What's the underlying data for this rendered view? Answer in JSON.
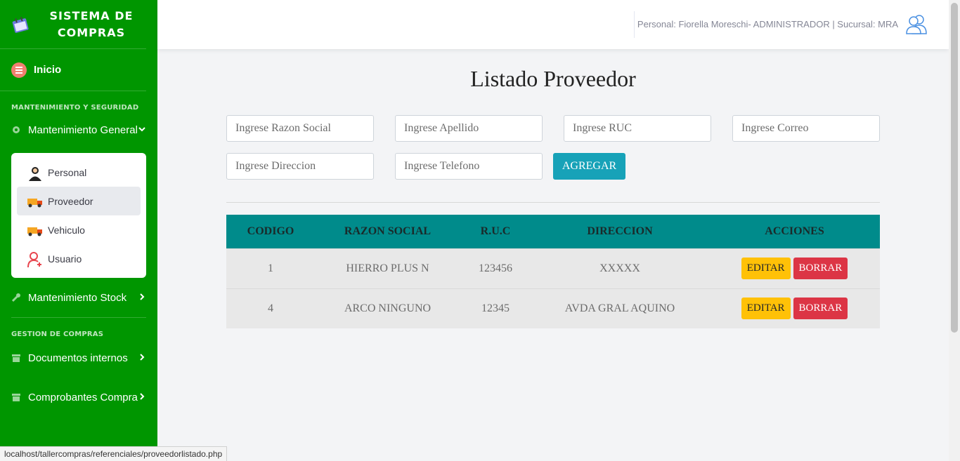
{
  "brand": {
    "line1": "SISTEMA DE",
    "line2": "COMPRAS"
  },
  "sidebar": {
    "home": "Inicio",
    "heading1": "MANTENIMIENTO Y SEGURIDAD",
    "mant_general": "Mantenimiento General",
    "submenu": [
      "Personal",
      "Proveedor",
      "Vehiculo",
      "Usuario"
    ],
    "active_submenu": "Proveedor",
    "mant_stock": "Mantenimiento Stock",
    "heading2": "GESTION DE COMPRAS",
    "docs": "Documentos internos",
    "comprobantes": "Comprobantes Compra"
  },
  "topbar": {
    "user_info": "Personal: Fiorella Moreschi- ADMINISTRADOR | Sucursal: MRA"
  },
  "page": {
    "title": "Listado Proveedor"
  },
  "form": {
    "razon_social": "Ingrese Razon Social",
    "apellido": "Ingrese Apellido",
    "ruc": "Ingrese RUC",
    "correo": "Ingrese Correo",
    "direccion": "Ingrese Direccion",
    "telefono": "Ingrese Telefono",
    "add_label": "AGREGAR"
  },
  "table": {
    "headers": [
      "CODIGO",
      "RAZON SOCIAL",
      "R.U.C",
      "DIRECCION",
      "ACCIONES"
    ],
    "rows": [
      {
        "codigo": "1",
        "razon": "HIERRO PLUS N",
        "ruc": "123456",
        "direccion": "XXXXX"
      },
      {
        "codigo": "4",
        "razon": "ARCO NINGUNO",
        "ruc": "12345",
        "direccion": "AVDA GRAL AQUINO"
      }
    ],
    "edit_label": "EDITAR",
    "delete_label": "BORRAR"
  },
  "status_url": "localhost/tallercompras/referenciales/proveedorlistado.php",
  "colors": {
    "sidebar": "#009600",
    "table_header": "#008b8b",
    "add_button": "#17a2b8",
    "edit": "#ffc107",
    "delete": "#dc3545"
  }
}
